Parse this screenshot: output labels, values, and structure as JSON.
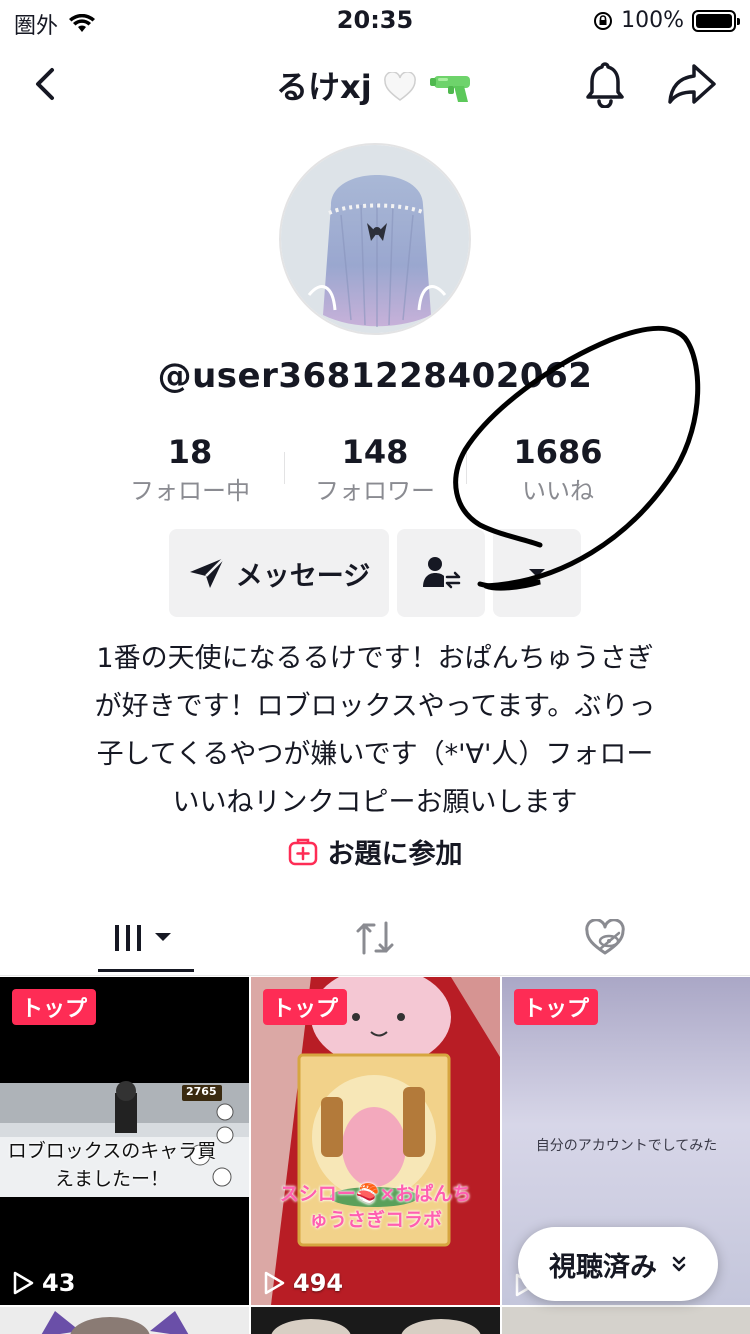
{
  "status_bar": {
    "carrier": "圏外",
    "time": "20:35",
    "battery": "100%",
    "battery_level": 1.0
  },
  "header": {
    "title": "るけxj"
  },
  "profile": {
    "username": "@user3681228402062",
    "stats": [
      {
        "value": "18",
        "label": "フォロー中"
      },
      {
        "value": "148",
        "label": "フォロワー"
      },
      {
        "value": "1686",
        "label": "いいね"
      }
    ],
    "message_button": "メッセージ",
    "bio_lines": [
      "1番の天使になるるけです！おぱんちゅうさぎ",
      "が好きです！ロブロックスやってます。ぶりっ",
      "子してくるやつが嫌いです（*'∀'人）フォロー",
      "いいねリンクコピーお願いします"
    ],
    "topic_link": "お題に参加"
  },
  "videos": [
    {
      "badge": "トップ",
      "views": "43",
      "caption": "ロブロックスのキャラ買えましたー！",
      "score_overlay": "2765"
    },
    {
      "badge": "トップ",
      "views": "494",
      "caption": "スシロー🍣×おぱんちゅうさぎコラボ"
    },
    {
      "badge": "トップ",
      "views": "",
      "caption": "自分のアカウントでしてみた"
    }
  ],
  "watched_button": "視聴済み",
  "colors": {
    "accent": "#fe2c55",
    "text": "#161823",
    "secondary_text": "#8a8b91",
    "button_bg": "#f1f1f2"
  }
}
